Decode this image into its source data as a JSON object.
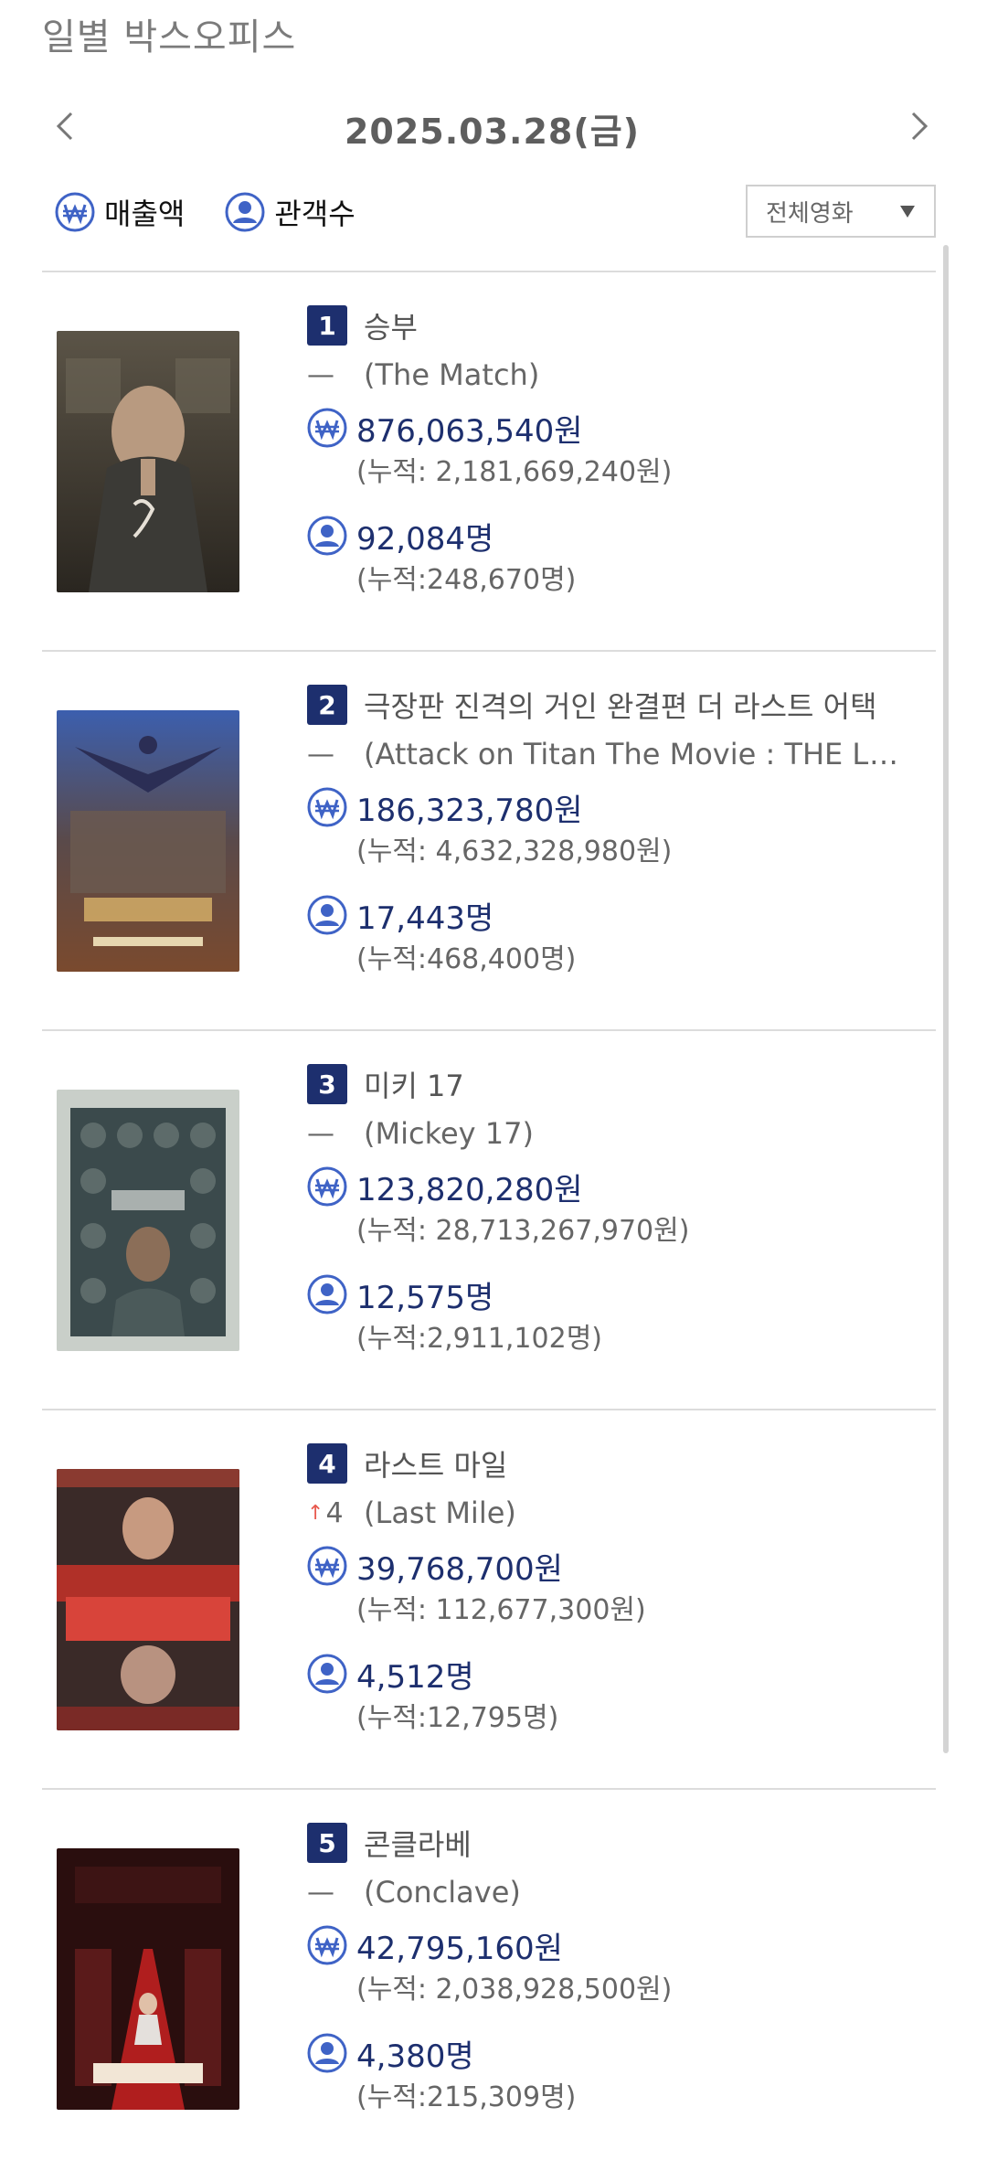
{
  "page": {
    "title": "일별 박스오피스"
  },
  "date": {
    "label": "2025.03.28(금)"
  },
  "tabs": {
    "revenue_label": "매출액",
    "audience_label": "관객수"
  },
  "filter": {
    "selected": "전체영화"
  },
  "colors": {
    "accent": "#1d2f6e",
    "icon_blue": "#3f63c6",
    "up_arrow": "#e85a4f"
  },
  "movies": [
    {
      "rank": "1",
      "title": "승부",
      "change": "—",
      "english": "(The Match)",
      "revenue": "876,063,540원",
      "revenue_total": "(누적: 2,181,669,240원)",
      "audience": "92,084명",
      "audience_total": "(누적:248,670명)"
    },
    {
      "rank": "2",
      "title": "극장판 진격의 거인 완결편 더 라스트 어택",
      "change": "—",
      "english": "(Attack on Titan The Movie : THE LAST A…",
      "revenue": "186,323,780원",
      "revenue_total": "(누적: 4,632,328,980원)",
      "audience": "17,443명",
      "audience_total": "(누적:468,400명)"
    },
    {
      "rank": "3",
      "title": "미키 17",
      "change": "—",
      "english": "(Mickey 17)",
      "revenue": "123,820,280원",
      "revenue_total": "(누적: 28,713,267,970원)",
      "audience": "12,575명",
      "audience_total": "(누적:2,911,102명)"
    },
    {
      "rank": "4",
      "title": "라스트 마일",
      "change": "4",
      "change_arrow": "↑",
      "english": "(Last Mile)",
      "revenue": "39,768,700원",
      "revenue_total": "(누적: 112,677,300원)",
      "audience": "4,512명",
      "audience_total": "(누적:12,795명)"
    },
    {
      "rank": "5",
      "title": "콘클라베",
      "change": "—",
      "english": "(Conclave)",
      "revenue": "42,795,160원",
      "revenue_total": "(누적: 2,038,928,500원)",
      "audience": "4,380명",
      "audience_total": "(누적:215,309명)"
    }
  ]
}
